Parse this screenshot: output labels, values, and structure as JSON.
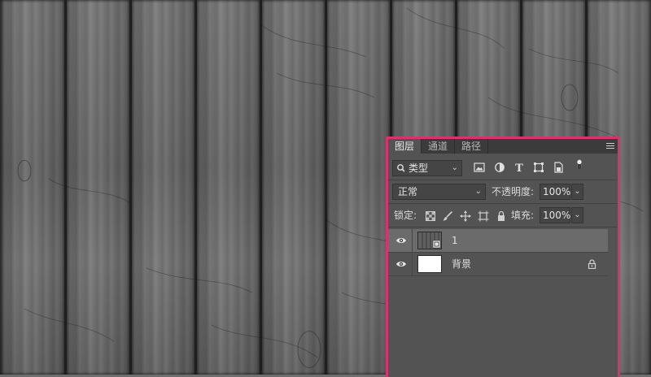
{
  "canvas": {
    "description_icon": "wood-texture"
  },
  "layers_panel": {
    "tabs": [
      {
        "label": "图层",
        "active": true
      },
      {
        "label": "通道",
        "active": false
      },
      {
        "label": "路径",
        "active": false
      }
    ],
    "menu_icon": "hamburger-menu-icon",
    "filter": {
      "kind_label": "类型",
      "icons": [
        "image-filter-icon",
        "adjustment-filter-icon",
        "type-filter-icon",
        "shape-filter-icon",
        "smart-object-filter-icon",
        "filter-toggle-icon"
      ]
    },
    "blend_mode": "正常",
    "opacity": {
      "label": "不透明度:",
      "value": "100%"
    },
    "lock": {
      "label": "锁定:",
      "icons": [
        "lock-transparency-icon",
        "lock-pixels-icon",
        "lock-position-icon",
        "lock-artboard-icon"
      ]
    },
    "fill": {
      "label": "填充:",
      "value": "100%"
    },
    "layers": [
      {
        "name": "1",
        "selected": true,
        "visible": true,
        "thumbnail": "smart-object-wood",
        "locked": false
      },
      {
        "name": "背景",
        "selected": false,
        "visible": true,
        "thumbnail": "white",
        "locked": true
      }
    ]
  },
  "colors": {
    "panel_bg": "#535353",
    "panel_border": "#d6336f",
    "tab_bar": "#3b3b3b",
    "selected_row": "#6b6b6b"
  }
}
